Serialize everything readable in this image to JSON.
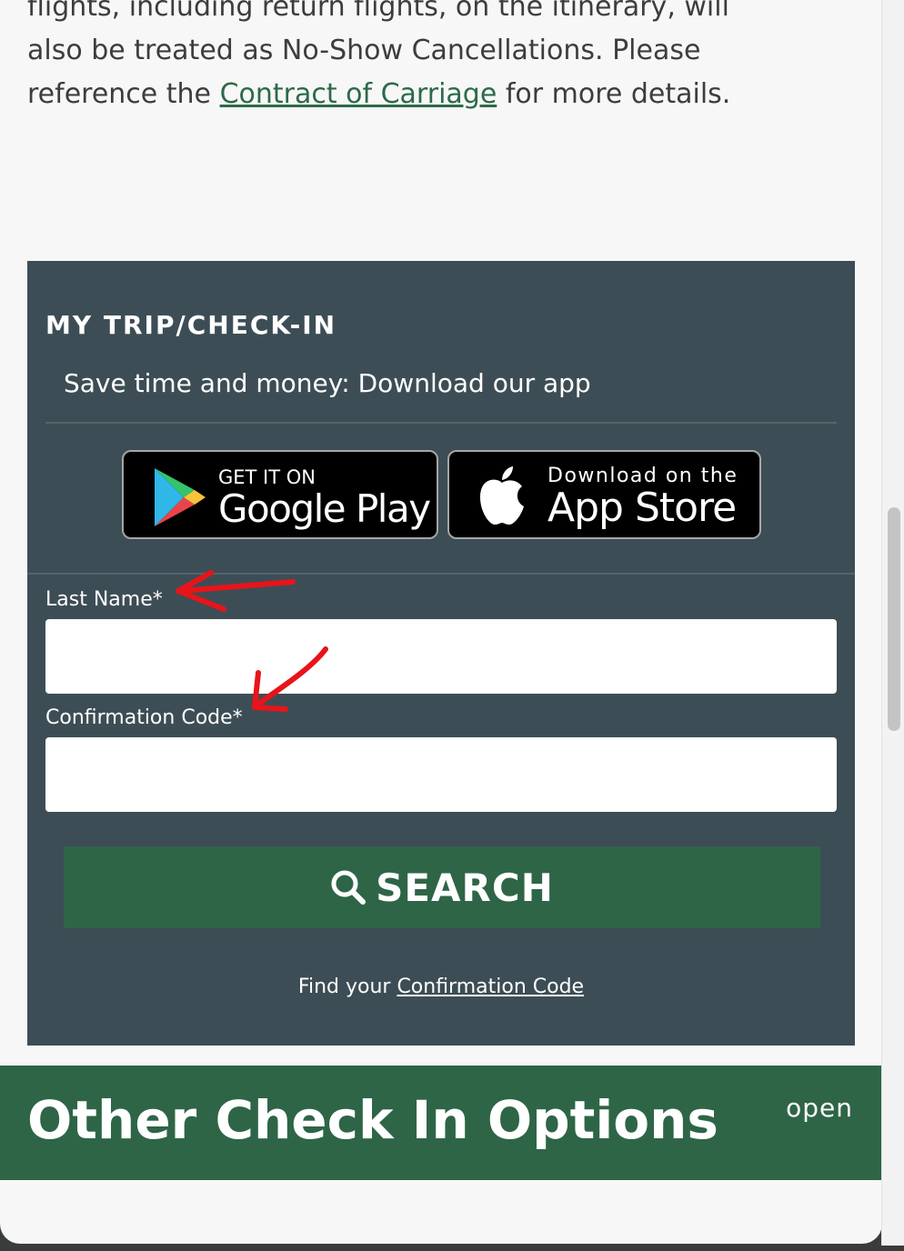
{
  "intro": {
    "line1": "flights, including return flights, on the itinerary, will",
    "line2": "also be treated as No-Show Cancellations. Please",
    "line3_prefix": "reference the ",
    "link": "Contract of Carriage",
    "line3_suffix": " for more details."
  },
  "trip": {
    "title": "MY TRIP/CHECK-IN",
    "subtitle": "Save time and money: Download our app",
    "google_play": {
      "small": "GET IT ON",
      "big": "Google Play"
    },
    "app_store": {
      "small": "Download on the",
      "big": "App Store"
    },
    "last_name_label": "Last Name*",
    "last_name_value": "",
    "confirmation_label": "Confirmation Code*",
    "confirmation_value": "",
    "search_label": "SEARCH",
    "find_prefix": "Find your ",
    "find_link": "Confirmation Code"
  },
  "other_options": {
    "title": "Other Check In Options",
    "toggle": "open"
  },
  "colors": {
    "panel": "#3d4d55",
    "accent_green": "#2e6547",
    "link_green": "#2d6a48",
    "annotation_red": "#e8141a"
  },
  "icons": [
    "google-play-logo-icon",
    "apple-logo-icon",
    "search-icon"
  ]
}
